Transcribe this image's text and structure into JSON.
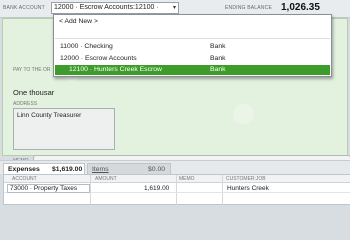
{
  "header": {
    "bank_account_label": "BANK ACCOUNT",
    "bank_account_value": "12000 · Escrow Accounts:12100 ·",
    "ending_balance_label": "ENDING BALANCE",
    "ending_balance_value": "1,026.35"
  },
  "account_dropdown": {
    "add_new": "< Add New >",
    "items": [
      {
        "name": "11000 · Checking",
        "type": "Bank",
        "selected": false
      },
      {
        "name": "12000 · Escrow Accounts",
        "type": "Bank",
        "selected": false
      },
      {
        "name": "12100 · Hunters Creek Escrow",
        "type": "Bank",
        "selected": true
      }
    ],
    "selected_color": "#3e9c2a"
  },
  "check": {
    "pay_to_label": "PAY TO THE OR",
    "amount_words": "One thousar",
    "address_label": "ADDRESS",
    "address_text": "Linn County Treasurer",
    "memo_label": "MEMO",
    "background_color": "#e3f1df"
  },
  "tabs": {
    "expenses_label": "Expenses",
    "expenses_value": "$1,619.00",
    "items_label": "Items",
    "items_value": "$0.00"
  },
  "grid": {
    "headers": [
      "ACCOUNT",
      "AMOUNT",
      "MEMO",
      "CUSTOMER:JOB"
    ],
    "rows": [
      {
        "account": "73000 · Property Taxes",
        "amount": "1,619.00",
        "memo": "",
        "customer_job": "Hunters Creek"
      }
    ]
  }
}
